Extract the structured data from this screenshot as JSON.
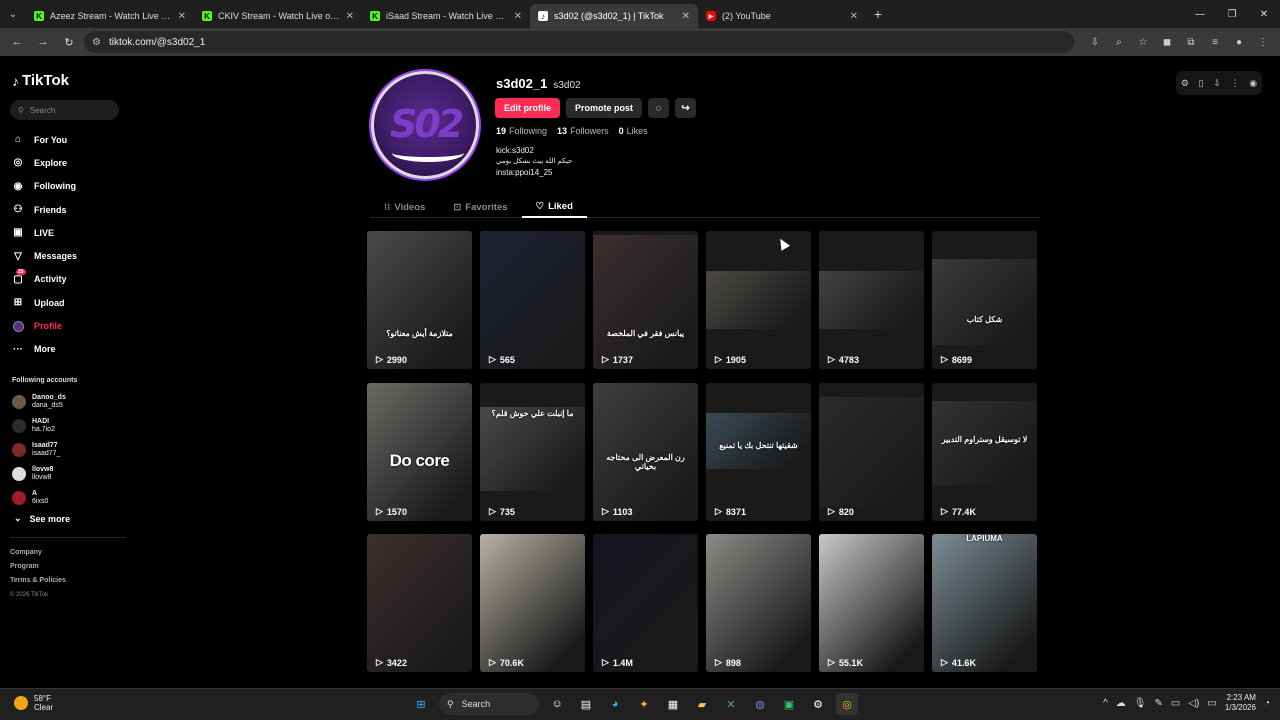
{
  "browser": {
    "tabs": [
      {
        "title": "Azeez Stream - Watch Live on Kick",
        "icon": "kick-icon",
        "active": false
      },
      {
        "title": "CKIV Stream - Watch Live on Kick",
        "icon": "kick-icon",
        "active": false
      },
      {
        "title": "iSaad Stream - Watch Live on Kick",
        "icon": "kick-icon",
        "active": false
      },
      {
        "title": "s3d02 (@s3d02_1) | TikTok",
        "icon": "tiktok-icon",
        "active": true
      },
      {
        "title": "(2) YouTube",
        "icon": "youtube-icon",
        "active": false
      }
    ],
    "url": "tiktok.com/@s3d02_1"
  },
  "sidebar": {
    "brand": "TikTok",
    "search_placeholder": "Search",
    "nav": [
      {
        "label": "For You",
        "icon": "home-icon"
      },
      {
        "label": "Explore",
        "icon": "compass-icon"
      },
      {
        "label": "Following",
        "icon": "following-icon"
      },
      {
        "label": "Friends",
        "icon": "friends-icon"
      },
      {
        "label": "LIVE",
        "icon": "live-icon"
      },
      {
        "label": "Messages",
        "icon": "messages-icon"
      },
      {
        "label": "Activity",
        "icon": "activity-icon",
        "badge": "25"
      },
      {
        "label": "Upload",
        "icon": "upload-icon"
      },
      {
        "label": "Profile",
        "icon": "profile-icon",
        "active": true
      },
      {
        "label": "More",
        "icon": "more-icon"
      }
    ],
    "following_title": "Following accounts",
    "following": [
      {
        "name": "Danoo_ds",
        "handle": "dana_ds5"
      },
      {
        "name": "HADI",
        "handle": "ha.7io2"
      },
      {
        "name": "Isaad77",
        "handle": "isaad77_"
      },
      {
        "name": "llovw8",
        "handle": "llovw8"
      },
      {
        "name": "A",
        "handle": "6ixs0"
      }
    ],
    "see_more": "See more",
    "footer": [
      "Company",
      "Program",
      "Terms & Policies"
    ],
    "copyright": "© 2026 TikTok"
  },
  "profile": {
    "username": "s3d02_1",
    "nickname": "s3d02",
    "edit_label": "Edit profile",
    "promote_label": "Promote post",
    "following_count": "19",
    "following_label": "Following",
    "followers_count": "13",
    "followers_label": "Followers",
    "likes_count": "0",
    "likes_label": "Likes",
    "bio": [
      "kick:s3d02",
      "حيكم الله بيث بشكل يومي",
      "insta:ppoi14_25"
    ]
  },
  "profile_tabs": [
    {
      "label": "Videos",
      "icon": "grid-icon"
    },
    {
      "label": "Favorites",
      "icon": "bookmark-icon"
    },
    {
      "label": "Liked",
      "icon": "heart-icon",
      "active": true
    }
  ],
  "videos": [
    {
      "views": "2990",
      "caption": "متلازمة أيش معناتو؟"
    },
    {
      "views": "565",
      "caption": ""
    },
    {
      "views": "1737",
      "caption": "يبانس فقر في الملخصة"
    },
    {
      "views": "1905",
      "caption": ""
    },
    {
      "views": "4783",
      "caption": ""
    },
    {
      "views": "8699",
      "caption": "شكل كتاب"
    },
    {
      "views": "1570",
      "caption": "Do core"
    },
    {
      "views": "735",
      "caption": "ما إنبلت علي حوش قلم؟"
    },
    {
      "views": "1103",
      "caption": "رن المعرض الى محتاجه بحياتي"
    },
    {
      "views": "8371",
      "caption": "شقيتها تنتحل بك يا تمنيع"
    },
    {
      "views": "820",
      "caption": ""
    },
    {
      "views": "77.4K",
      "caption": "لا توسيقل وستراوم التدبير"
    },
    {
      "views": "3422",
      "caption": ""
    },
    {
      "views": "70.6K",
      "caption": ""
    },
    {
      "views": "1.4M",
      "caption": ""
    },
    {
      "views": "898",
      "caption": ""
    },
    {
      "views": "55.1K",
      "caption": ""
    },
    {
      "views": "41.6K",
      "caption": "LAPIUMA"
    }
  ],
  "taskbar": {
    "temp": "58°F",
    "condition": "Clear",
    "search_label": "Search",
    "time": "2:23 AM",
    "date": "1/3/2026"
  }
}
